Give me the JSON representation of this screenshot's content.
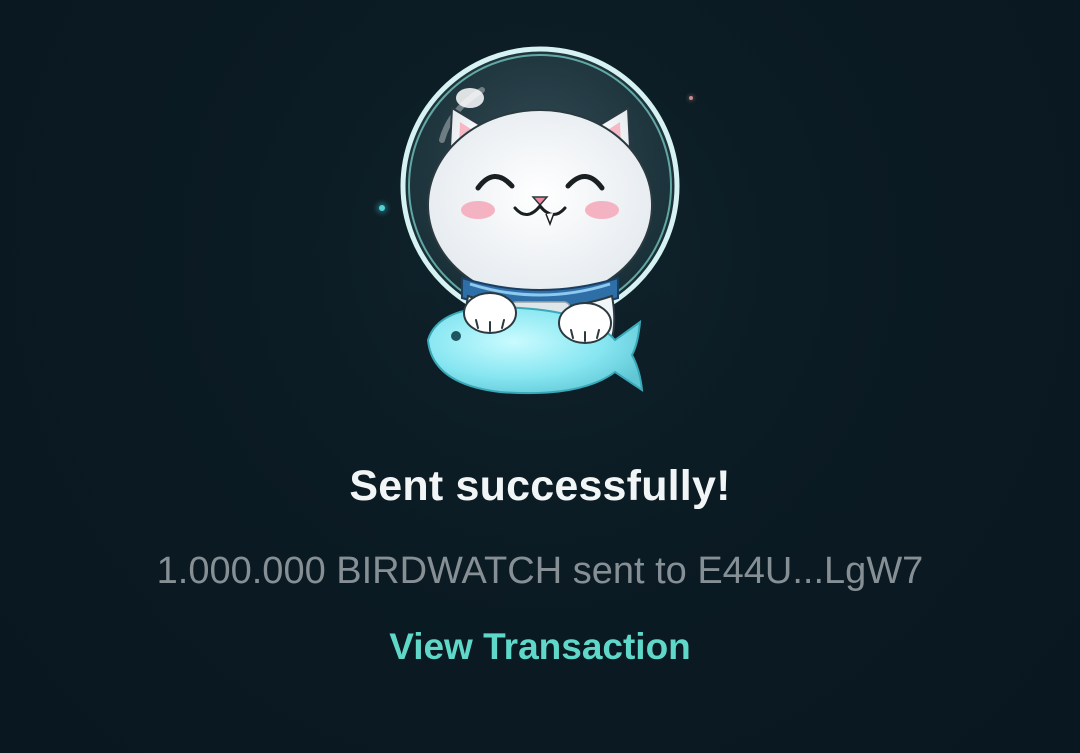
{
  "status": {
    "title": "Sent successfully!",
    "message": "1.000.000 BIRDWATCH sent to E44U...LgW7"
  },
  "actions": {
    "view_transaction_label": "View Transaction"
  },
  "illustration": {
    "icon": "astronaut-cat-illustration"
  },
  "colors": {
    "background": "#0a1922",
    "title": "#f2f5f6",
    "message": "#858f94",
    "accent": "#5fd8c9"
  }
}
